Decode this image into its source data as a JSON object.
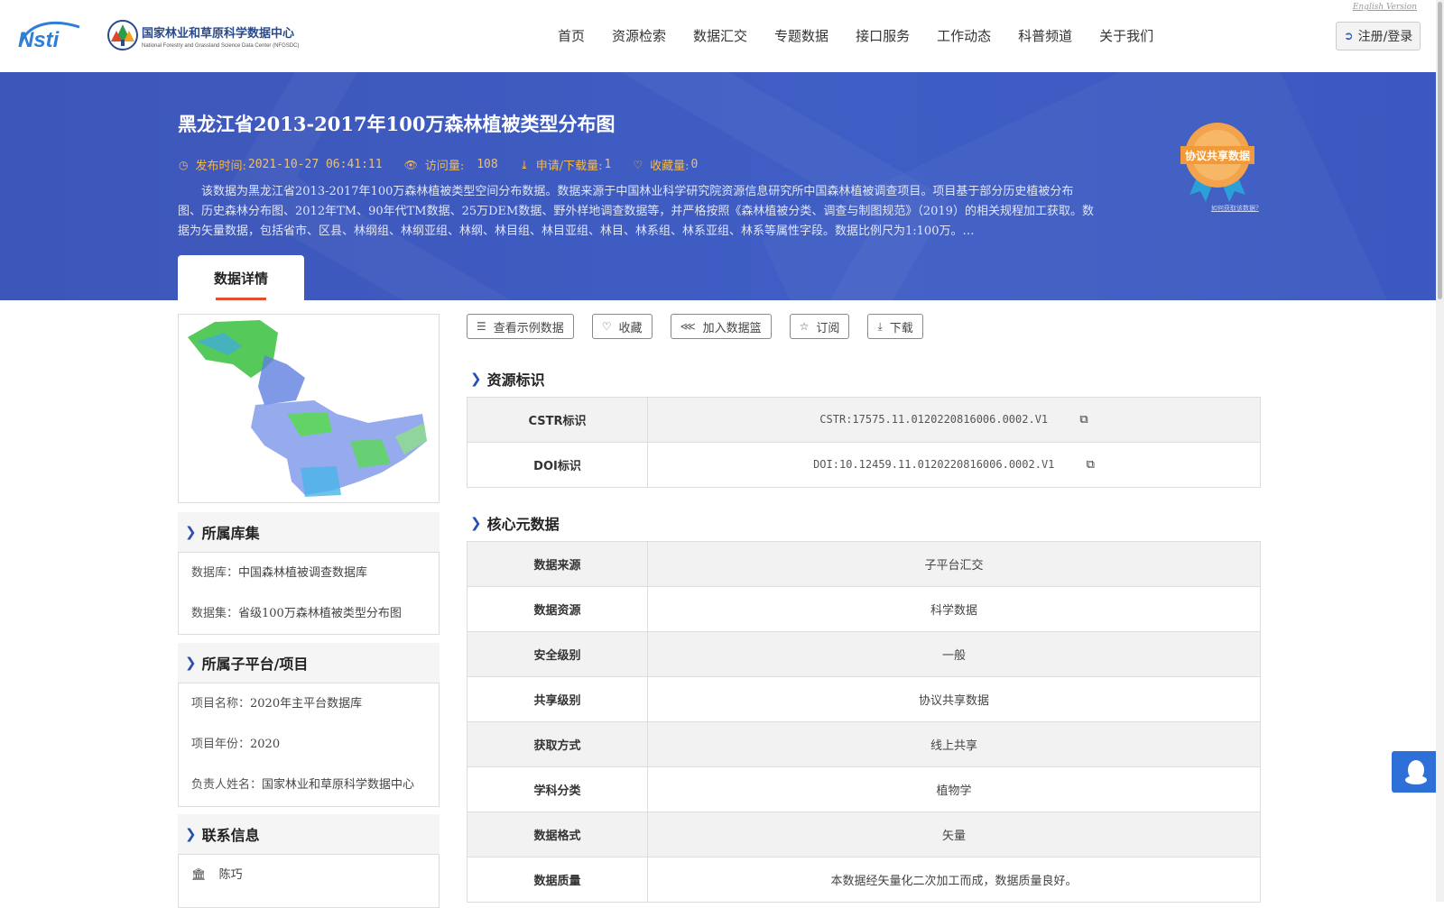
{
  "header": {
    "logo_nsti": "Nsti",
    "logo_cn": "国家林业和草原科学数据中心",
    "logo_en": "National Forestry and Grassland Science Data Center (NFGSDC)",
    "english_link": "English Version",
    "nav": [
      "首页",
      "资源检索",
      "数据汇交",
      "专题数据",
      "接口服务",
      "工作动态",
      "科普频道",
      "关于我们"
    ],
    "login_label": "注册/登录"
  },
  "banner": {
    "title": "黑龙江省2013-2017年100万森林植被类型分布图",
    "publish_label": "发布时间:",
    "publish_value": "2021-10-27 06:41:11",
    "visits_label": "访问量:",
    "visits_value": "108",
    "downloads_label": "申请/下载量:",
    "downloads_value": "1",
    "favorites_label": "收藏量:",
    "favorites_value": "0",
    "description": "该数据为黑龙江省2013-2017年100万森林植被类型空间分布数据。数据来源于中国林业科学研究院资源信息研究所中国森林植被调查项目。项目基于部分历史植被分布图、历史森林分布图、2012年TM、90年代TM数据、25万DEM数据、野外样地调查数据等，并严格按照《森林植被分类、调查与制图规范》（2019）的相关规程加工获取。数据为矢量数据，包括省市、区县、林纲组、林纲亚组、林纲、林目组、林目亚组、林目、林系组、林系亚组、林系等属性字段。数据比例尺为1:100万。…",
    "badge_text": "协议共享数据",
    "badge_link": "如何获取该数据?",
    "tab_label": "数据详情"
  },
  "left": {
    "collection_title": "所属库集",
    "collection_rows": [
      {
        "label": "数据库：",
        "value": "中国森林植被调查数据库"
      },
      {
        "label": "数据集：",
        "value": "省级100万森林植被类型分布图"
      }
    ],
    "platform_title": "所属子平台/项目",
    "platform_rows": [
      {
        "label": "项目名称：",
        "value": "2020年主平台数据库"
      },
      {
        "label": "项目年份：",
        "value": "2020"
      },
      {
        "label": "负责人姓名：",
        "value": "国家林业和草原科学数据中心"
      }
    ],
    "contact_title": "联系信息",
    "contact_name": "陈巧"
  },
  "actions": [
    "查看示例数据",
    "收藏",
    "加入数据篮",
    "订阅",
    "下载"
  ],
  "resource_id": {
    "title": "资源标识",
    "rows": [
      {
        "key": "CSTR标识",
        "value": "CSTR:17575.11.0120220816006.0002.V1"
      },
      {
        "key": "DOI标识",
        "value": "DOI:10.12459.11.0120220816006.0002.V1"
      }
    ]
  },
  "core_meta": {
    "title": "核心元数据",
    "rows": [
      {
        "key": "数据来源",
        "value": "子平台汇交"
      },
      {
        "key": "数据资源",
        "value": "科学数据"
      },
      {
        "key": "安全级别",
        "value": "一般"
      },
      {
        "key": "共享级别",
        "value": "协议共享数据"
      },
      {
        "key": "获取方式",
        "value": "线上共享"
      },
      {
        "key": "学科分类",
        "value": "植物学"
      },
      {
        "key": "数据格式",
        "value": "矢量"
      },
      {
        "key": "数据质量",
        "value": "本数据经矢量化二次加工而成，数据质量良好。"
      }
    ]
  },
  "colors": {
    "banner": "#3f5ec5",
    "accent_orange": "#f5b94a",
    "tab_underline": "#e24f2e",
    "chevron": "#2a4fb0",
    "qq_button": "#2e6fd8"
  }
}
